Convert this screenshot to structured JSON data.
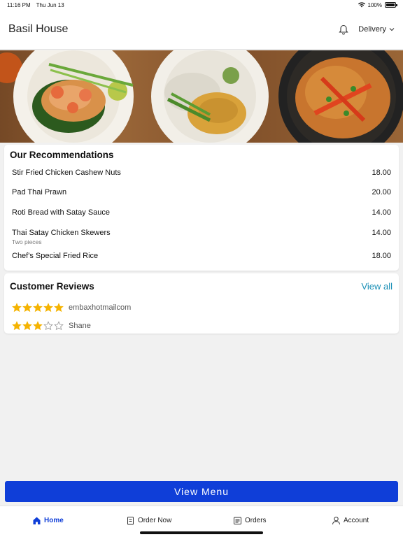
{
  "status_bar": {
    "time": "11:16 PM",
    "date": "Thu Jun 13",
    "battery": "100%"
  },
  "header": {
    "title": "Basil House",
    "delivery_label": "Delivery"
  },
  "recommendations": {
    "title": "Our Recommendations",
    "items": [
      {
        "name": "Stir Fried Chicken Cashew Nuts",
        "price": "18.00",
        "note": ""
      },
      {
        "name": "Pad Thai Prawn",
        "price": "20.00",
        "note": ""
      },
      {
        "name": "Roti Bread with Satay Sauce",
        "price": "14.00",
        "note": ""
      },
      {
        "name": "Thai Satay Chicken Skewers",
        "price": "14.00",
        "note": "Two pieces"
      },
      {
        "name": "Chef's Special Fried Rice",
        "price": "18.00",
        "note": ""
      }
    ]
  },
  "reviews": {
    "title": "Customer Reviews",
    "view_all_label": "View all",
    "items": [
      {
        "reviewer": "embaxhotmailcom",
        "rating": 5
      },
      {
        "reviewer": "Shane",
        "rating": 3
      }
    ]
  },
  "view_menu_label": "View Menu",
  "tabs": [
    {
      "label": "Home",
      "icon": "home-icon",
      "active": true
    },
    {
      "label": "Order Now",
      "icon": "order-icon",
      "active": false
    },
    {
      "label": "Orders",
      "icon": "orders-icon",
      "active": false
    },
    {
      "label": "Account",
      "icon": "account-icon",
      "active": false
    }
  ],
  "colors": {
    "accent": "#0f3ed8",
    "link": "#1a8fb6",
    "star": "#f5b301"
  }
}
